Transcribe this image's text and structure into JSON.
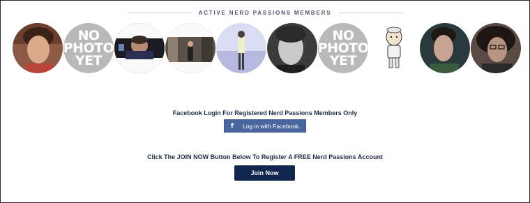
{
  "members_section": {
    "heading": "ACTIVE NERD PASSIONS MEMBERS",
    "members": [
      {
        "type": "photo"
      },
      {
        "type": "placeholder",
        "lines": [
          "NO",
          "PHOTO",
          "YET"
        ]
      },
      {
        "type": "photo"
      },
      {
        "type": "photo"
      },
      {
        "type": "photo"
      },
      {
        "type": "photo"
      },
      {
        "type": "placeholder",
        "lines": [
          "NO",
          "PHOTO",
          "YET"
        ]
      },
      {
        "type": "cartoon"
      },
      {
        "type": "photo"
      },
      {
        "type": "photo"
      }
    ]
  },
  "facebook": {
    "prompt": "Facebook Login For Registered Nerd Passions Members Only",
    "icon": "f",
    "button_label": "Log in with Facebook."
  },
  "join": {
    "prompt": "Click The JOIN NOW Button Below To Register A FREE Nerd Passions Account",
    "button_label": "Join Now"
  },
  "colors": {
    "facebook_blue": "#4a66a0",
    "join_navy": "#10264e",
    "text_navy": "#1e2a46"
  }
}
